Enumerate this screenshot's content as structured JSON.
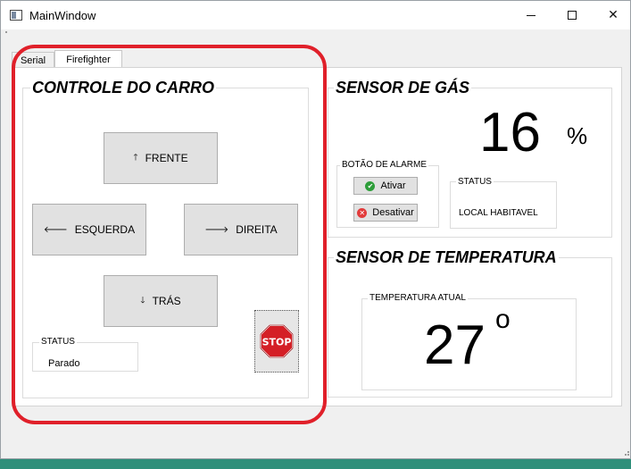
{
  "window": {
    "title": "MainWindow"
  },
  "tabs": [
    {
      "label": "Serial",
      "active": false
    },
    {
      "label": "Firefighter",
      "active": true
    }
  ],
  "car_control": {
    "title": "CONTROLE DO CARRO",
    "buttons": {
      "forward": {
        "label": "FRENTE",
        "icon": "arrow-up-icon"
      },
      "left": {
        "label": "ESQUERDA",
        "icon": "arrow-left-icon"
      },
      "right": {
        "label": "DIREITA",
        "icon": "arrow-right-icon"
      },
      "back": {
        "label": "TRÁS",
        "icon": "arrow-down-icon"
      },
      "stop": {
        "label": "STOP",
        "icon": "stop-sign-icon"
      }
    },
    "status": {
      "title": "STATUS",
      "value": "Parado"
    }
  },
  "gas_sensor": {
    "title": "SENSOR DE GÁS",
    "value": "16",
    "unit": "%",
    "alarm": {
      "title": "BOTÃO DE ALARME",
      "activate_label": "Ativar",
      "deactivate_label": "Desativar"
    },
    "status": {
      "title": "STATUS",
      "value": "LOCAL HABITAVEL"
    }
  },
  "temperature_sensor": {
    "title": "SENSOR DE TEMPERATURA",
    "current": {
      "title": "TEMPERATURA ATUAL",
      "value": "27",
      "unit": "o"
    }
  },
  "colors": {
    "highlight_outline": "#e0202a",
    "activate_icon": "#2e9e3a",
    "deactivate_icon": "#e23b3b",
    "stop_sign": "#d41f26",
    "taskbar": "#2e8f7a"
  }
}
